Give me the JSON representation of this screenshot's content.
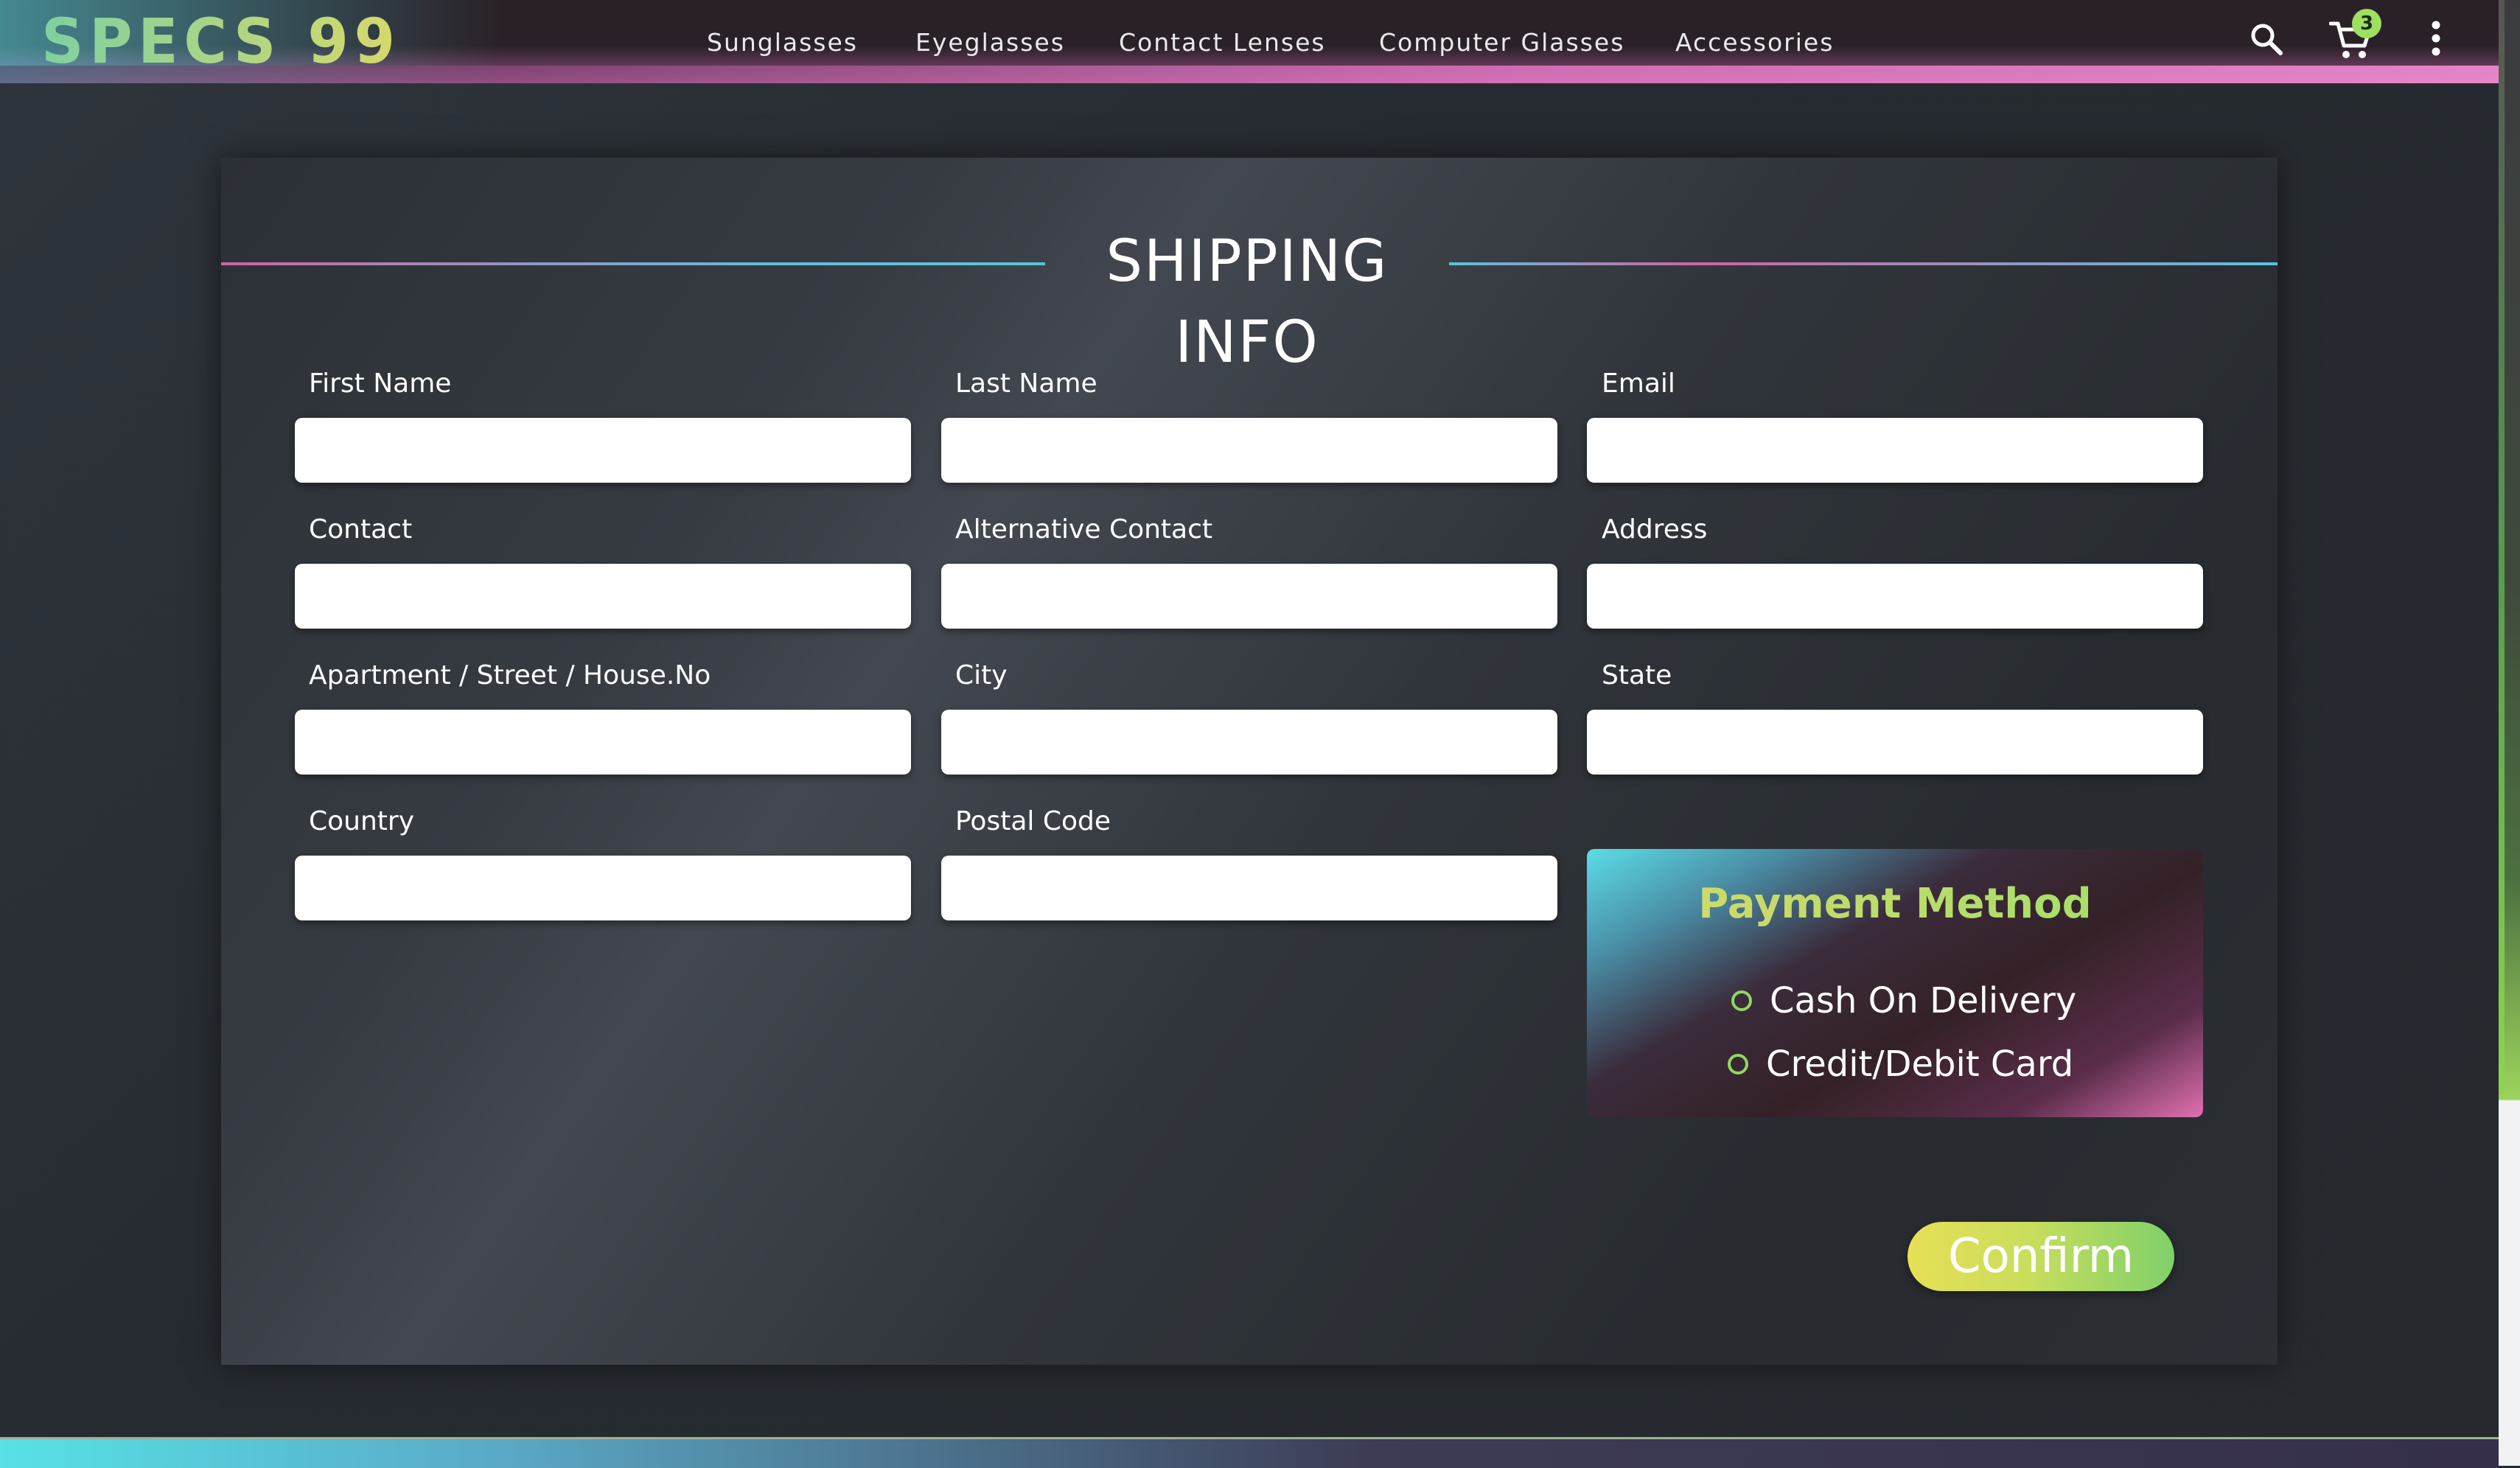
{
  "brand": {
    "logo_text": "SPECS 99"
  },
  "nav": {
    "items": [
      {
        "label": "Sunglasses"
      },
      {
        "label": "Eyeglasses"
      },
      {
        "label": "Contact Lenses"
      },
      {
        "label": "Computer Glasses"
      },
      {
        "label": "Accessories"
      }
    ]
  },
  "header_icons": {
    "search": "search-icon",
    "cart": "cart-icon",
    "cart_count": "3",
    "menu": "kebab-menu-icon"
  },
  "form": {
    "title": "SHIPPING INFO",
    "fields": [
      {
        "label": "First Name",
        "value": "",
        "placeholder": ""
      },
      {
        "label": "Last Name",
        "value": "",
        "placeholder": ""
      },
      {
        "label": "Email",
        "value": "",
        "placeholder": ""
      },
      {
        "label": "Contact",
        "value": "",
        "placeholder": ""
      },
      {
        "label": "Alternative Contact",
        "value": "",
        "placeholder": ""
      },
      {
        "label": "Address",
        "value": "",
        "placeholder": ""
      },
      {
        "label": "Apartment / Street / House.No",
        "value": "",
        "placeholder": ""
      },
      {
        "label": "City",
        "value": "",
        "placeholder": ""
      },
      {
        "label": "State",
        "value": "",
        "placeholder": ""
      },
      {
        "label": "Country",
        "value": "",
        "placeholder": ""
      },
      {
        "label": "Postal Code",
        "value": "",
        "placeholder": ""
      }
    ],
    "payment": {
      "title": "Payment Method",
      "options": [
        {
          "label": "Cash On Delivery",
          "selected": false
        },
        {
          "label": "Credit/Debit Card",
          "selected": false
        }
      ]
    },
    "confirm_label": "Confirm"
  },
  "colors": {
    "accent_green": "#9ee05f",
    "accent_yellow": "#e8df56",
    "accent_cyan": "#5bc1de",
    "accent_pink": "#d0649f",
    "background": "#2b3036"
  }
}
